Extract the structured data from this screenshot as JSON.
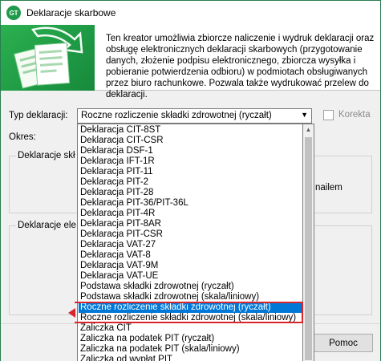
{
  "window": {
    "title": "Deklaracje skarbowe",
    "icon_name": "app-logo-icon"
  },
  "banner": {
    "text": "Ten kreator umożliwia zbiorcze naliczenie i wydruk deklaracji oraz obsługę elektronicznych deklaracji skarbowych (przygotowanie danych, złożenie podpisu elektronicznego, zbiorcza wysyłka i pobieranie potwierdzenia odbioru) w podmiotach obsługiwanych przez biuro rachunkowe. Pozwala także wydrukować przelew do deklaracji."
  },
  "form": {
    "type_label": "Typ deklaracji:",
    "type_value": "Roczne rozliczenie składki zdrowotnej (ryczałt)",
    "korekta_label": "Korekta",
    "korekta_checked": false,
    "okres_label": "Okres:",
    "group1_title": "Deklaracje skł",
    "group1_partial": "nailem",
    "group2_title": "Deklaracje ele"
  },
  "buttons": {
    "help": "Pomoc"
  },
  "dropdown": {
    "selected_index": 17,
    "items": [
      "Deklaracja CIT-8ST",
      "Deklaracja CIT-CSR",
      "Deklaracja DSF-1",
      "Deklaracja IFT-1R",
      "Deklaracja PIT-11",
      "Deklaracja PIT-2",
      "Deklaracja PIT-28",
      "Deklaracja PIT-36/PIT-36L",
      "Deklaracja PIT-4R",
      "Deklaracja PIT-8AR",
      "Deklaracja PIT-CSR",
      "Deklaracja VAT-27",
      "Deklaracja VAT-8",
      "Deklaracja VAT-9M",
      "Deklaracja VAT-UE",
      "Podstawa składki zdrowotnej (ryczałt)",
      "Podstawa składki zdrowotnej (skala/liniowy)",
      "Roczne rozliczenie składki zdrowotnej (ryczałt)",
      "Roczne rozliczenie składki zdrowotnej (skala/liniowy)",
      "Zaliczka CIT",
      "Zaliczka na podatek PIT (ryczałt)",
      "Zaliczka na podatek PIT (skala/liniowy)",
      "Zaliczka od wypłat PIT"
    ]
  },
  "colors": {
    "selection": "#0078d7",
    "annotation": "#d8262c",
    "brand_green": "#1e9a4a"
  }
}
